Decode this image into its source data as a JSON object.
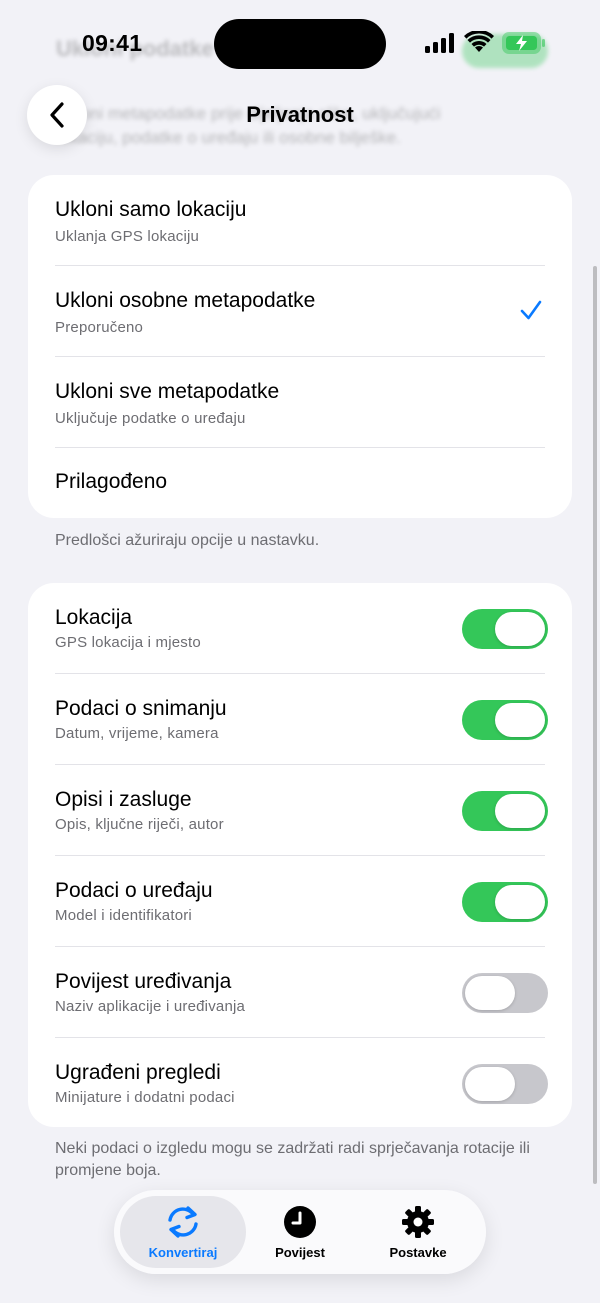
{
  "status_bar": {
    "time": "09:41"
  },
  "nav": {
    "title": "Privatnost"
  },
  "background_ghost": {
    "title": "Ukloni podatke",
    "description": "Ukloni metapodatke prije dijeljenja slike, uključujući lokaciju, podatke o uređaju ili osobne bilješke."
  },
  "presets": {
    "items": [
      {
        "title": "Ukloni samo lokaciju",
        "subtitle": "Uklanja GPS lokaciju",
        "selected": false
      },
      {
        "title": "Ukloni osobne metapodatke",
        "subtitle": "Preporučeno",
        "selected": true
      },
      {
        "title": "Ukloni sve metapodatke",
        "subtitle": "Uključuje podatke o uređaju",
        "selected": false
      },
      {
        "title": "Prilagođeno",
        "subtitle": "",
        "selected": false
      }
    ],
    "footer": "Predlošci ažuriraju opcije u nastavku."
  },
  "options": {
    "items": [
      {
        "title": "Lokacija",
        "subtitle": "GPS lokacija i mjesto",
        "enabled": true
      },
      {
        "title": "Podaci o snimanju",
        "subtitle": "Datum, vrijeme, kamera",
        "enabled": true
      },
      {
        "title": "Opisi i zasluge",
        "subtitle": "Opis, ključne riječi, autor",
        "enabled": true
      },
      {
        "title": "Podaci o uređaju",
        "subtitle": "Model i identifikatori",
        "enabled": true
      },
      {
        "title": "Povijest uređivanja",
        "subtitle": "Naziv aplikacije i uređivanja",
        "enabled": false
      },
      {
        "title": "Ugrađeni pregledi",
        "subtitle": "Minijature i dodatni podaci",
        "enabled": false
      }
    ],
    "footer": "Neki podaci o izgledu mogu se zadržati radi sprječavanja rotacije ili promjene boja."
  },
  "tab_bar": {
    "tabs": [
      {
        "label": "Konvertiraj",
        "icon": "convert-arrows-icon",
        "active": true
      },
      {
        "label": "Povijest",
        "icon": "clock-icon",
        "active": false
      },
      {
        "label": "Postavke",
        "icon": "gear-icon",
        "active": false
      }
    ]
  },
  "colors": {
    "accent": "#0A7AFF",
    "toggle_on": "#34C759",
    "toggle_off": "#C7C7CC",
    "background": "#F2F2F7"
  }
}
